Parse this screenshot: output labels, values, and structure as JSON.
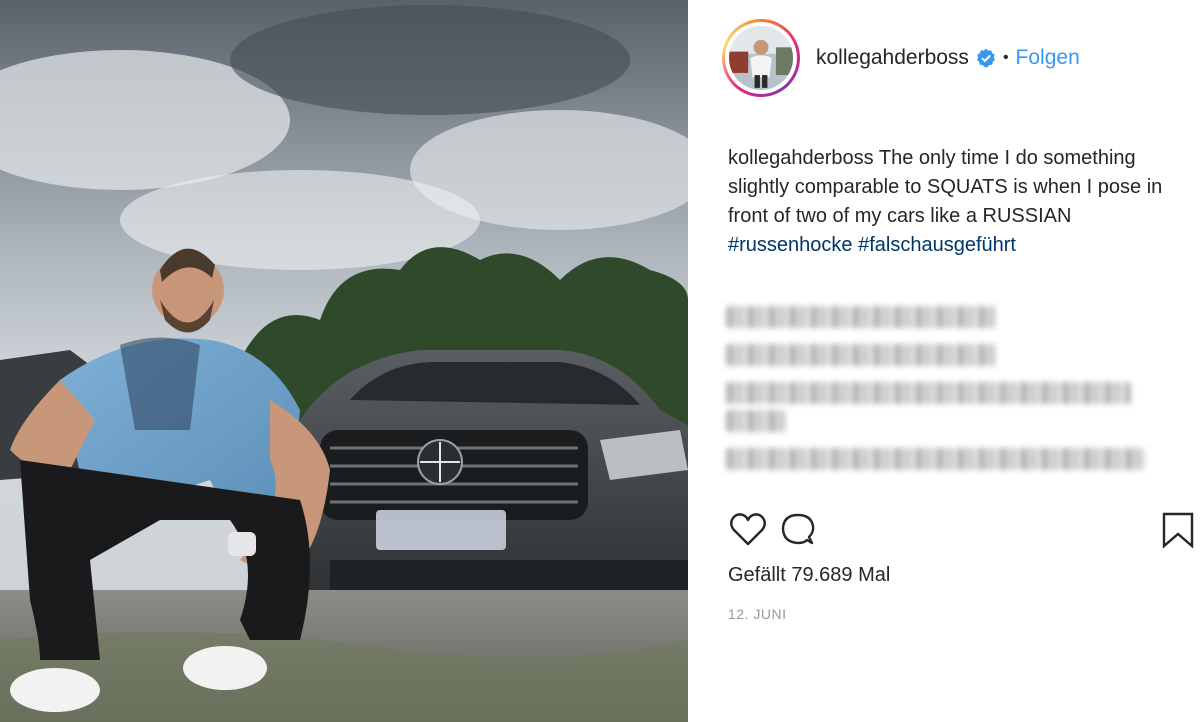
{
  "post": {
    "username": "kollegahderboss",
    "separator": "•",
    "follow_label": "Folgen",
    "caption_user": "kollegahderboss",
    "caption_text": "The only time I do something slightly comparable to SQUATS is when I pose in front of two of my cars like a RUSSIAN",
    "hashtags": [
      "#russenhocke",
      "#falschausgeführt"
    ],
    "likes_text": "Gefällt 79.689 Mal",
    "date_text": "12. JUNI"
  },
  "icons": {
    "verified": "verified-badge-icon",
    "like": "heart-icon",
    "comment": "comment-bubble-icon",
    "save": "bookmark-icon"
  },
  "colors": {
    "link": "#3897f0",
    "hashtag": "#003569",
    "text": "#262626",
    "muted": "#999999"
  }
}
